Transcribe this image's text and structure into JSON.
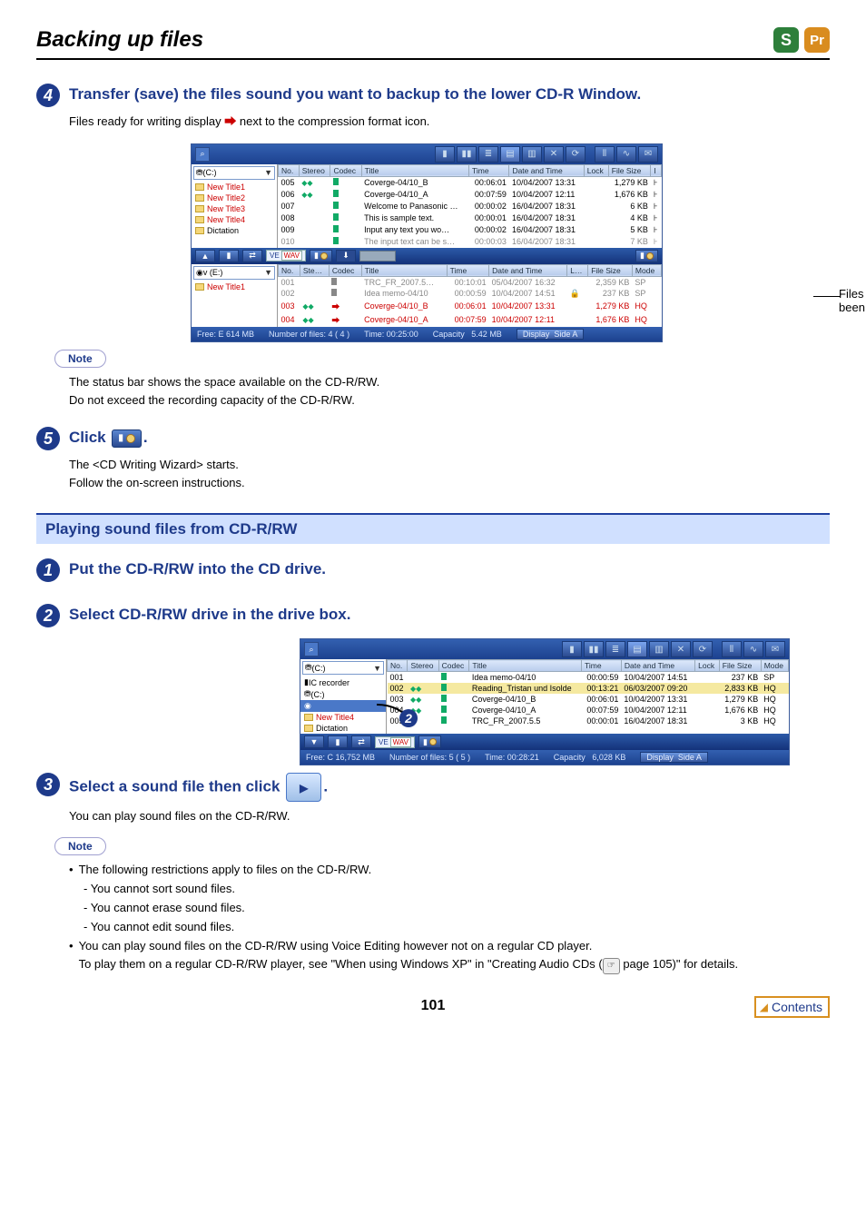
{
  "page": {
    "title": "Backing up files",
    "number": "101"
  },
  "apps": {
    "s": "S",
    "pr": "Pr"
  },
  "step4": {
    "num": "4",
    "heading": "Transfer (save) the files sound you want to backup to the lower CD-R Window.",
    "body": "Files ready for writing display          next to the compression format icon."
  },
  "step4Note": {
    "label": "Note",
    "line1": "The status bar shows the space available on the CD-R/RW.",
    "line2": "Do not exceed the recording capacity of the CD-R/RW."
  },
  "step5": {
    "num": "5",
    "headingBefore": "Click ",
    "headingAfter": ".",
    "body1": "The <CD Writing Wizard> starts.",
    "body2": "Follow the on-screen instructions."
  },
  "section2": "Playing sound files from CD-R/RW",
  "p1": {
    "num": "1",
    "heading": "Put the CD-R/RW into the CD drive."
  },
  "p2": {
    "num": "2",
    "heading": "Select CD-R/RW drive in the drive box."
  },
  "p3": {
    "num": "3",
    "headingBefore": "Select a sound file then click ",
    "headingAfter": ".",
    "body": "You can play sound files on the CD-R/RW."
  },
  "p3Note": {
    "label": "Note",
    "b1": "The following restrictions apply to files on the CD-R/RW.",
    "s1": "- You cannot sort sound files.",
    "s2": "- You cannot erase sound files.",
    "s3": "- You cannot edit sound files.",
    "b2a": "You can play sound files on the CD-R/RW using Voice Editing however not on a regular CD player.",
    "b2b": "To play them on a regular CD-R/RW player, see \"When using Windows XP\" in \"Creating Audio CDs (",
    "b2c": " page 105)\" for details."
  },
  "callout": {
    "line1": "Files that have",
    "line2": "been written."
  },
  "contentsBtn": "Contents",
  "screenshot1": {
    "topDrive": "(C:)",
    "topTree": [
      {
        "label": "New Title1",
        "red": true
      },
      {
        "label": "New Title2",
        "red": true
      },
      {
        "label": "New Title3",
        "red": true
      },
      {
        "label": "New Title4",
        "red": true
      },
      {
        "label": "Dictation",
        "red": false
      }
    ],
    "topCols": [
      "No.",
      "Stereo",
      "Codec",
      "Title",
      "Time",
      "Date and Time",
      "Lock",
      "File Size",
      "I"
    ],
    "topRows": [
      {
        "no": "005",
        "st": true,
        "t": "Coverge-04/10_B",
        "time": "00:06:01",
        "dt": "10/04/2007 13:31",
        "fs": "1,279 KB"
      },
      {
        "no": "006",
        "st": true,
        "t": "Coverge-04/10_A",
        "time": "00:07:59",
        "dt": "10/04/2007 12:11",
        "fs": "1,676 KB"
      },
      {
        "no": "007",
        "st": false,
        "t": "Welcome to Panasonic …",
        "time": "00:00:02",
        "dt": "16/04/2007 18:31",
        "fs": "6 KB"
      },
      {
        "no": "008",
        "st": false,
        "t": "This is sample text.",
        "time": "00:00:01",
        "dt": "16/04/2007 18:31",
        "fs": "4 KB"
      },
      {
        "no": "009",
        "st": false,
        "t": "Input any text you wo…",
        "time": "00:00:02",
        "dt": "16/04/2007 18:31",
        "fs": "5 KB"
      },
      {
        "no": "010",
        "st": false,
        "t": "The input text can be s…",
        "time": "00:00:03",
        "dt": "16/04/2007 18:31",
        "fs": "7 KB",
        "grey": true
      }
    ],
    "lowerDrive": "v (E:)",
    "lowerTree": [
      {
        "label": "New Title1",
        "red": true
      }
    ],
    "lowerCols": [
      "No.",
      "Ste…",
      "Codec",
      "Title",
      "Time",
      "Date and Time",
      "L…",
      "File Size",
      "Mode"
    ],
    "lowerRows": [
      {
        "no": "001",
        "t": "TRC_FR_2007.5…",
        "time": "00:10:01",
        "dt": "05/04/2007 16:32",
        "fs": "2,359 KB",
        "mode": "SP",
        "grey": true
      },
      {
        "no": "002",
        "t": "Idea memo-04/10",
        "time": "00:00:59",
        "dt": "10/04/2007 14:51",
        "fs": "237 KB",
        "mode": "SP",
        "grey": true,
        "lock": true
      },
      {
        "no": "003",
        "st": true,
        "t": "Coverge-04/10_B",
        "time": "00:06:01",
        "dt": "10/04/2007 13:31",
        "fs": "1,279 KB",
        "mode": "HQ",
        "red": true
      },
      {
        "no": "004",
        "st": true,
        "t": "Coverge-04/10_A",
        "time": "00:07:59",
        "dt": "10/04/2007 12:11",
        "fs": "1,676 KB",
        "mode": "HQ",
        "red": true
      }
    ],
    "status": {
      "free": "Free: E 614 MB",
      "nfiles": "Number of files: 4 ( 4 )",
      "time": "Time: 00:25:00",
      "cap": "Capacity",
      "capv": "5.42 MB",
      "disp": "Display",
      "side": "Side A"
    }
  },
  "screenshot2": {
    "drive": "(C:)",
    "tree": [
      {
        "label": "IC recorder",
        "kind": "ic"
      },
      {
        "label": "(C:)",
        "kind": "drive"
      },
      {
        "label": "",
        "kind": "cd",
        "sel": true
      },
      {
        "label": "New Title4",
        "kind": "folder",
        "red": true
      },
      {
        "label": "Dictation",
        "kind": "folder"
      }
    ],
    "cols": [
      "No.",
      "Stereo",
      "Codec",
      "Title",
      "Time",
      "Date and Time",
      "Lock",
      "File Size",
      "Mode"
    ],
    "rows": [
      {
        "no": "001",
        "t": "Idea memo-04/10",
        "time": "00:00:59",
        "dt": "10/04/2007 14:51",
        "fs": "237 KB",
        "mode": "SP"
      },
      {
        "no": "002",
        "st": true,
        "t": "Reading_Tristan und Isolde",
        "time": "00:13:21",
        "dt": "06/03/2007 09:20",
        "fs": "2,833 KB",
        "mode": "HQ",
        "sel": true
      },
      {
        "no": "003",
        "st": true,
        "t": "Coverge-04/10_B",
        "time": "00:06:01",
        "dt": "10/04/2007 13:31",
        "fs": "1,279 KB",
        "mode": "HQ"
      },
      {
        "no": "004",
        "st": true,
        "t": "Coverge-04/10_A",
        "time": "00:07:59",
        "dt": "10/04/2007 12:11",
        "fs": "1,676 KB",
        "mode": "HQ"
      },
      {
        "no": "005",
        "t": "TRC_FR_2007.5.5",
        "time": "00:00:01",
        "dt": "16/04/2007 18:31",
        "fs": "3 KB",
        "mode": "HQ"
      }
    ],
    "status": {
      "free": "Free: C 16,752 MB",
      "nfiles": "Number of files: 5 ( 5 )",
      "time": "Time: 00:28:21",
      "cap": "Capacity",
      "capv": "6,028 KB",
      "disp": "Display",
      "side": "Side A"
    }
  }
}
